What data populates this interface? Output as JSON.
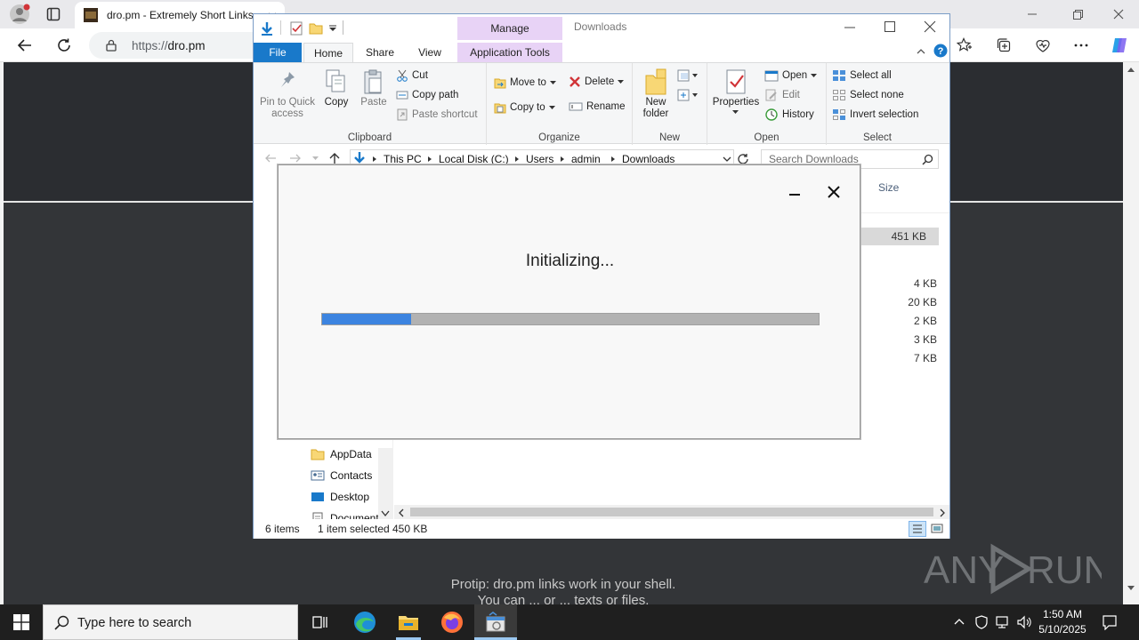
{
  "browser": {
    "tab_title": "dro.pm - Extremely Short Links",
    "url": "https://dro.pm",
    "url_scheme": "https://",
    "url_host": "dro.pm"
  },
  "page": {
    "protip_line1": "Protip: dro.pm links work in your shell.",
    "protip_line2": "You can ... or ... texts or files.",
    "watermark": "ANY RUN"
  },
  "explorer": {
    "window_title": "Downloads",
    "context_tab": "Manage",
    "tabs": {
      "file": "File",
      "home": "Home",
      "share": "Share",
      "view": "View",
      "app_tools": "Application Tools"
    },
    "ribbon": {
      "clipboard": {
        "label": "Clipboard",
        "pin": "Pin to Quick access",
        "copy": "Copy",
        "paste": "Paste",
        "cut": "Cut",
        "copy_path": "Copy path",
        "paste_shortcut": "Paste shortcut"
      },
      "organize": {
        "label": "Organize",
        "move_to": "Move to",
        "copy_to": "Copy to",
        "delete": "Delete",
        "rename": "Rename"
      },
      "new": {
        "label": "New",
        "new_folder": "New folder"
      },
      "open": {
        "label": "Open",
        "properties": "Properties",
        "open": "Open",
        "edit": "Edit",
        "history": "History"
      },
      "select": {
        "label": "Select",
        "select_all": "Select all",
        "select_none": "Select none",
        "invert": "Invert selection"
      }
    },
    "breadcrumb": [
      "This PC",
      "Local Disk (C:)",
      "Users",
      "admin",
      "Downloads"
    ],
    "search_placeholder": "Search Downloads",
    "size_header": "Size",
    "file_sizes": [
      "451 KB",
      "4 KB",
      "20 KB",
      "2 KB",
      "3 KB",
      "7 KB"
    ],
    "nav_items": [
      "AppData",
      "Contacts",
      "Desktop",
      "Document"
    ],
    "status": {
      "items": "6 items",
      "selected": "1 item selected",
      "size": "450 KB"
    }
  },
  "dialog": {
    "message": "Initializing...",
    "progress": 0.18
  },
  "taskbar": {
    "search_placeholder": "Type here to search",
    "time": "1:50 AM",
    "date": "5/10/2025"
  },
  "colors": {
    "accent": "#1979ca",
    "progress": "#3c84e0",
    "manage_tab": "#e8d3f6"
  }
}
